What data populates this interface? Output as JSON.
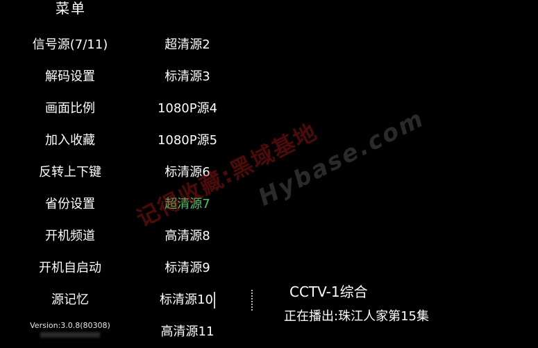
{
  "menu": {
    "title": "菜单",
    "items": [
      {
        "label": "信号源(7/11)"
      },
      {
        "label": "解码设置"
      },
      {
        "label": "画面比例"
      },
      {
        "label": "加入收藏"
      },
      {
        "label": "反转上下键"
      },
      {
        "label": "省份设置"
      },
      {
        "label": "开机频道"
      },
      {
        "label": "开机自启动"
      },
      {
        "label": "源记忆"
      }
    ],
    "version": "Version:3.0.8(80308)"
  },
  "sources": {
    "items": [
      {
        "label": "超清源2"
      },
      {
        "label": "标清源3"
      },
      {
        "label": "1080P源4"
      },
      {
        "label": "1080P源5"
      },
      {
        "label": "标清源6"
      },
      {
        "label": "超清源7"
      },
      {
        "label": "高清源8"
      },
      {
        "label": "标清源9"
      },
      {
        "label": "标清源10"
      },
      {
        "label": "高清源11"
      }
    ],
    "selected_label": "超清源7",
    "selected_index": 5
  },
  "channel": {
    "name": "CCTV-1综合",
    "now_playing": "正在播出:珠江人家第15集"
  },
  "watermark": {
    "line1": "记得收藏:黑域基地",
    "line2": "Hybase.com"
  },
  "colors": {
    "background": "#000000",
    "text": "#ffffff",
    "selected": "#4cc36a",
    "watermark_red": "#c81e1e"
  }
}
